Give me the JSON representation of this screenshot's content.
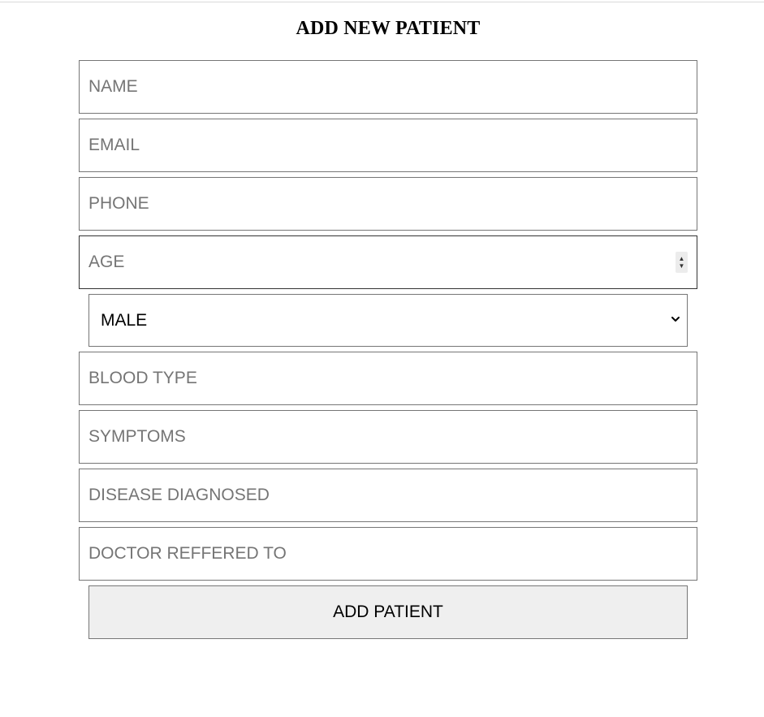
{
  "form": {
    "title": "ADD NEW PATIENT",
    "fields": {
      "name": {
        "placeholder": "NAME",
        "value": ""
      },
      "email": {
        "placeholder": "EMAIL",
        "value": ""
      },
      "phone": {
        "placeholder": "PHONE",
        "value": ""
      },
      "age": {
        "placeholder": "AGE",
        "value": ""
      },
      "gender": {
        "selected": "MALE"
      },
      "blood_type": {
        "placeholder": "BLOOD TYPE",
        "value": ""
      },
      "symptoms": {
        "placeholder": "SYMPTOMS",
        "value": ""
      },
      "disease": {
        "placeholder": "DISEASE DIAGNOSED",
        "value": ""
      },
      "doctor": {
        "placeholder": "DOCTOR REFFERED TO",
        "value": ""
      }
    },
    "submit_label": "ADD PATIENT"
  },
  "icons": {
    "age_stepper": "stepper-icon",
    "gender_dropdown": "chevron-down-icon"
  }
}
